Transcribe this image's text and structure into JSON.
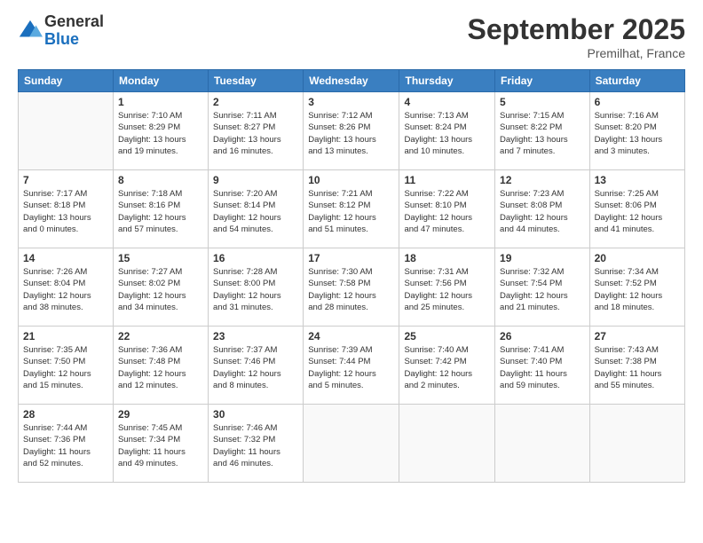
{
  "logo": {
    "general": "General",
    "blue": "Blue"
  },
  "header": {
    "title": "September 2025",
    "subtitle": "Premilhat, France"
  },
  "days_of_week": [
    "Sunday",
    "Monday",
    "Tuesday",
    "Wednesday",
    "Thursday",
    "Friday",
    "Saturday"
  ],
  "weeks": [
    [
      {
        "day": "",
        "info": ""
      },
      {
        "day": "1",
        "info": "Sunrise: 7:10 AM\nSunset: 8:29 PM\nDaylight: 13 hours\nand 19 minutes."
      },
      {
        "day": "2",
        "info": "Sunrise: 7:11 AM\nSunset: 8:27 PM\nDaylight: 13 hours\nand 16 minutes."
      },
      {
        "day": "3",
        "info": "Sunrise: 7:12 AM\nSunset: 8:26 PM\nDaylight: 13 hours\nand 13 minutes."
      },
      {
        "day": "4",
        "info": "Sunrise: 7:13 AM\nSunset: 8:24 PM\nDaylight: 13 hours\nand 10 minutes."
      },
      {
        "day": "5",
        "info": "Sunrise: 7:15 AM\nSunset: 8:22 PM\nDaylight: 13 hours\nand 7 minutes."
      },
      {
        "day": "6",
        "info": "Sunrise: 7:16 AM\nSunset: 8:20 PM\nDaylight: 13 hours\nand 3 minutes."
      }
    ],
    [
      {
        "day": "7",
        "info": "Sunrise: 7:17 AM\nSunset: 8:18 PM\nDaylight: 13 hours\nand 0 minutes."
      },
      {
        "day": "8",
        "info": "Sunrise: 7:18 AM\nSunset: 8:16 PM\nDaylight: 12 hours\nand 57 minutes."
      },
      {
        "day": "9",
        "info": "Sunrise: 7:20 AM\nSunset: 8:14 PM\nDaylight: 12 hours\nand 54 minutes."
      },
      {
        "day": "10",
        "info": "Sunrise: 7:21 AM\nSunset: 8:12 PM\nDaylight: 12 hours\nand 51 minutes."
      },
      {
        "day": "11",
        "info": "Sunrise: 7:22 AM\nSunset: 8:10 PM\nDaylight: 12 hours\nand 47 minutes."
      },
      {
        "day": "12",
        "info": "Sunrise: 7:23 AM\nSunset: 8:08 PM\nDaylight: 12 hours\nand 44 minutes."
      },
      {
        "day": "13",
        "info": "Sunrise: 7:25 AM\nSunset: 8:06 PM\nDaylight: 12 hours\nand 41 minutes."
      }
    ],
    [
      {
        "day": "14",
        "info": "Sunrise: 7:26 AM\nSunset: 8:04 PM\nDaylight: 12 hours\nand 38 minutes."
      },
      {
        "day": "15",
        "info": "Sunrise: 7:27 AM\nSunset: 8:02 PM\nDaylight: 12 hours\nand 34 minutes."
      },
      {
        "day": "16",
        "info": "Sunrise: 7:28 AM\nSunset: 8:00 PM\nDaylight: 12 hours\nand 31 minutes."
      },
      {
        "day": "17",
        "info": "Sunrise: 7:30 AM\nSunset: 7:58 PM\nDaylight: 12 hours\nand 28 minutes."
      },
      {
        "day": "18",
        "info": "Sunrise: 7:31 AM\nSunset: 7:56 PM\nDaylight: 12 hours\nand 25 minutes."
      },
      {
        "day": "19",
        "info": "Sunrise: 7:32 AM\nSunset: 7:54 PM\nDaylight: 12 hours\nand 21 minutes."
      },
      {
        "day": "20",
        "info": "Sunrise: 7:34 AM\nSunset: 7:52 PM\nDaylight: 12 hours\nand 18 minutes."
      }
    ],
    [
      {
        "day": "21",
        "info": "Sunrise: 7:35 AM\nSunset: 7:50 PM\nDaylight: 12 hours\nand 15 minutes."
      },
      {
        "day": "22",
        "info": "Sunrise: 7:36 AM\nSunset: 7:48 PM\nDaylight: 12 hours\nand 12 minutes."
      },
      {
        "day": "23",
        "info": "Sunrise: 7:37 AM\nSunset: 7:46 PM\nDaylight: 12 hours\nand 8 minutes."
      },
      {
        "day": "24",
        "info": "Sunrise: 7:39 AM\nSunset: 7:44 PM\nDaylight: 12 hours\nand 5 minutes."
      },
      {
        "day": "25",
        "info": "Sunrise: 7:40 AM\nSunset: 7:42 PM\nDaylight: 12 hours\nand 2 minutes."
      },
      {
        "day": "26",
        "info": "Sunrise: 7:41 AM\nSunset: 7:40 PM\nDaylight: 11 hours\nand 59 minutes."
      },
      {
        "day": "27",
        "info": "Sunrise: 7:43 AM\nSunset: 7:38 PM\nDaylight: 11 hours\nand 55 minutes."
      }
    ],
    [
      {
        "day": "28",
        "info": "Sunrise: 7:44 AM\nSunset: 7:36 PM\nDaylight: 11 hours\nand 52 minutes."
      },
      {
        "day": "29",
        "info": "Sunrise: 7:45 AM\nSunset: 7:34 PM\nDaylight: 11 hours\nand 49 minutes."
      },
      {
        "day": "30",
        "info": "Sunrise: 7:46 AM\nSunset: 7:32 PM\nDaylight: 11 hours\nand 46 minutes."
      },
      {
        "day": "",
        "info": ""
      },
      {
        "day": "",
        "info": ""
      },
      {
        "day": "",
        "info": ""
      },
      {
        "day": "",
        "info": ""
      }
    ]
  ]
}
